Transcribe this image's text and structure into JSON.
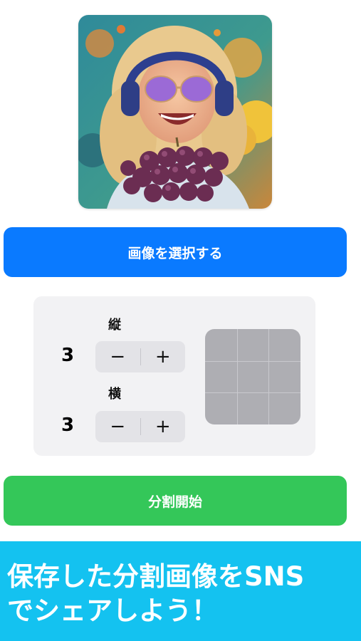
{
  "colors": {
    "select_button": "#0a7aff",
    "start_button": "#34c759",
    "banner": "#14c2f0"
  },
  "image_preview": {
    "alt": "illustration: girl with headphones and purple sunglasses holding grapes"
  },
  "select_button": {
    "label": "画像を選択する"
  },
  "split_settings": {
    "rows": {
      "label": "縦",
      "value": "3",
      "minus": "−",
      "plus": "+"
    },
    "cols": {
      "label": "横",
      "value": "3",
      "minus": "−",
      "plus": "+"
    },
    "grid_rows": 3,
    "grid_cols": 3
  },
  "start_button": {
    "label": "分割開始"
  },
  "banner": {
    "line1": "保存した分割画像をSNS",
    "line2": "でシェアしよう！"
  }
}
